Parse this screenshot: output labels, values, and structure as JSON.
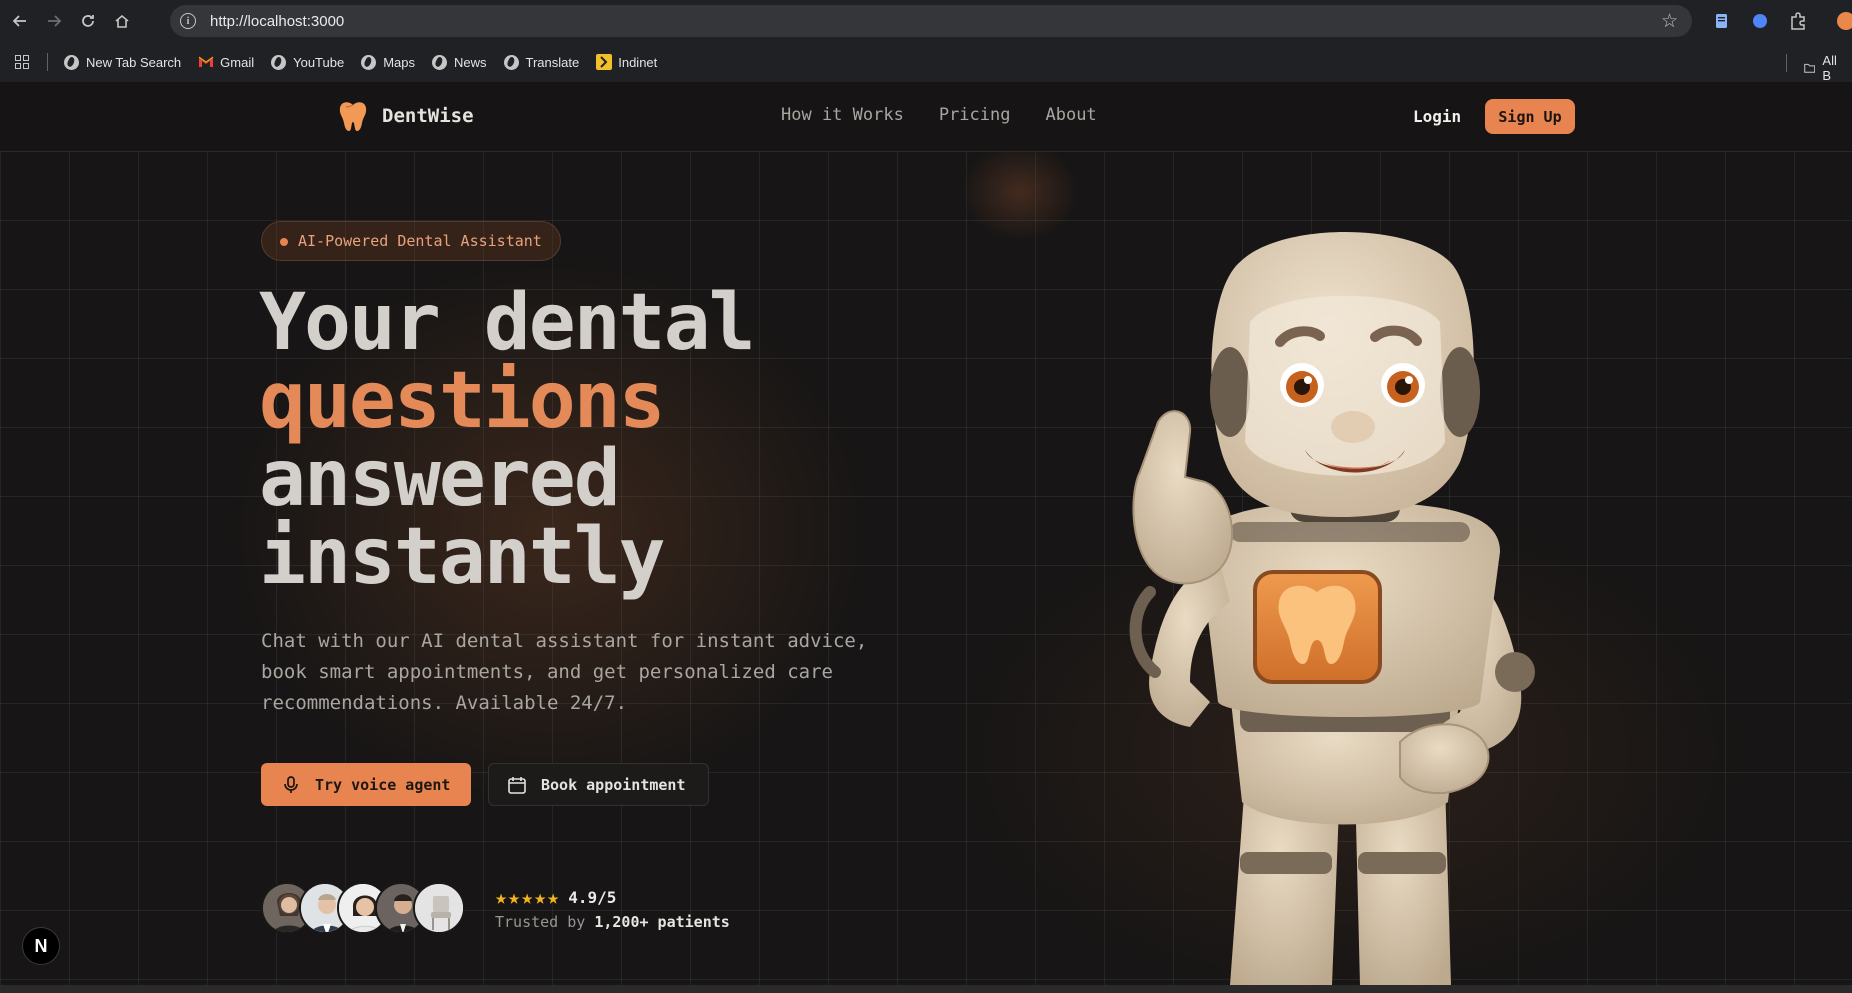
{
  "browser": {
    "url": "http://localhost:3000",
    "bookmarks": [
      {
        "label": "New Tab Search"
      },
      {
        "label": "Gmail"
      },
      {
        "label": "YouTube"
      },
      {
        "label": "Maps"
      },
      {
        "label": "News"
      },
      {
        "label": "Translate"
      },
      {
        "label": "Indinet"
      }
    ],
    "all_bookmarks_label": "All B"
  },
  "header": {
    "brand": "DentWise",
    "nav": [
      "How it Works",
      "Pricing",
      "About"
    ],
    "login": "Login",
    "signup": "Sign Up"
  },
  "hero": {
    "badge": "AI-Powered Dental Assistant",
    "headline": {
      "line1": "Your dental",
      "line2": "questions",
      "line3": "answered",
      "line4": "instantly"
    },
    "subtext": "Chat with our AI dental assistant for instant advice, book smart appointments, and get personalized care recommendations. Available 24/7.",
    "primary_cta": "Try voice agent",
    "secondary_cta": "Book appointment",
    "rating": {
      "stars": "★★★★★",
      "value": "4.9/5",
      "trusted_prefix": "Trusted by ",
      "trusted_count": "1,200+ patients"
    }
  },
  "dev": {
    "next_badge": "N"
  },
  "colors": {
    "accent": "#e88450",
    "background": "#171515",
    "star": "#f2b51f"
  }
}
